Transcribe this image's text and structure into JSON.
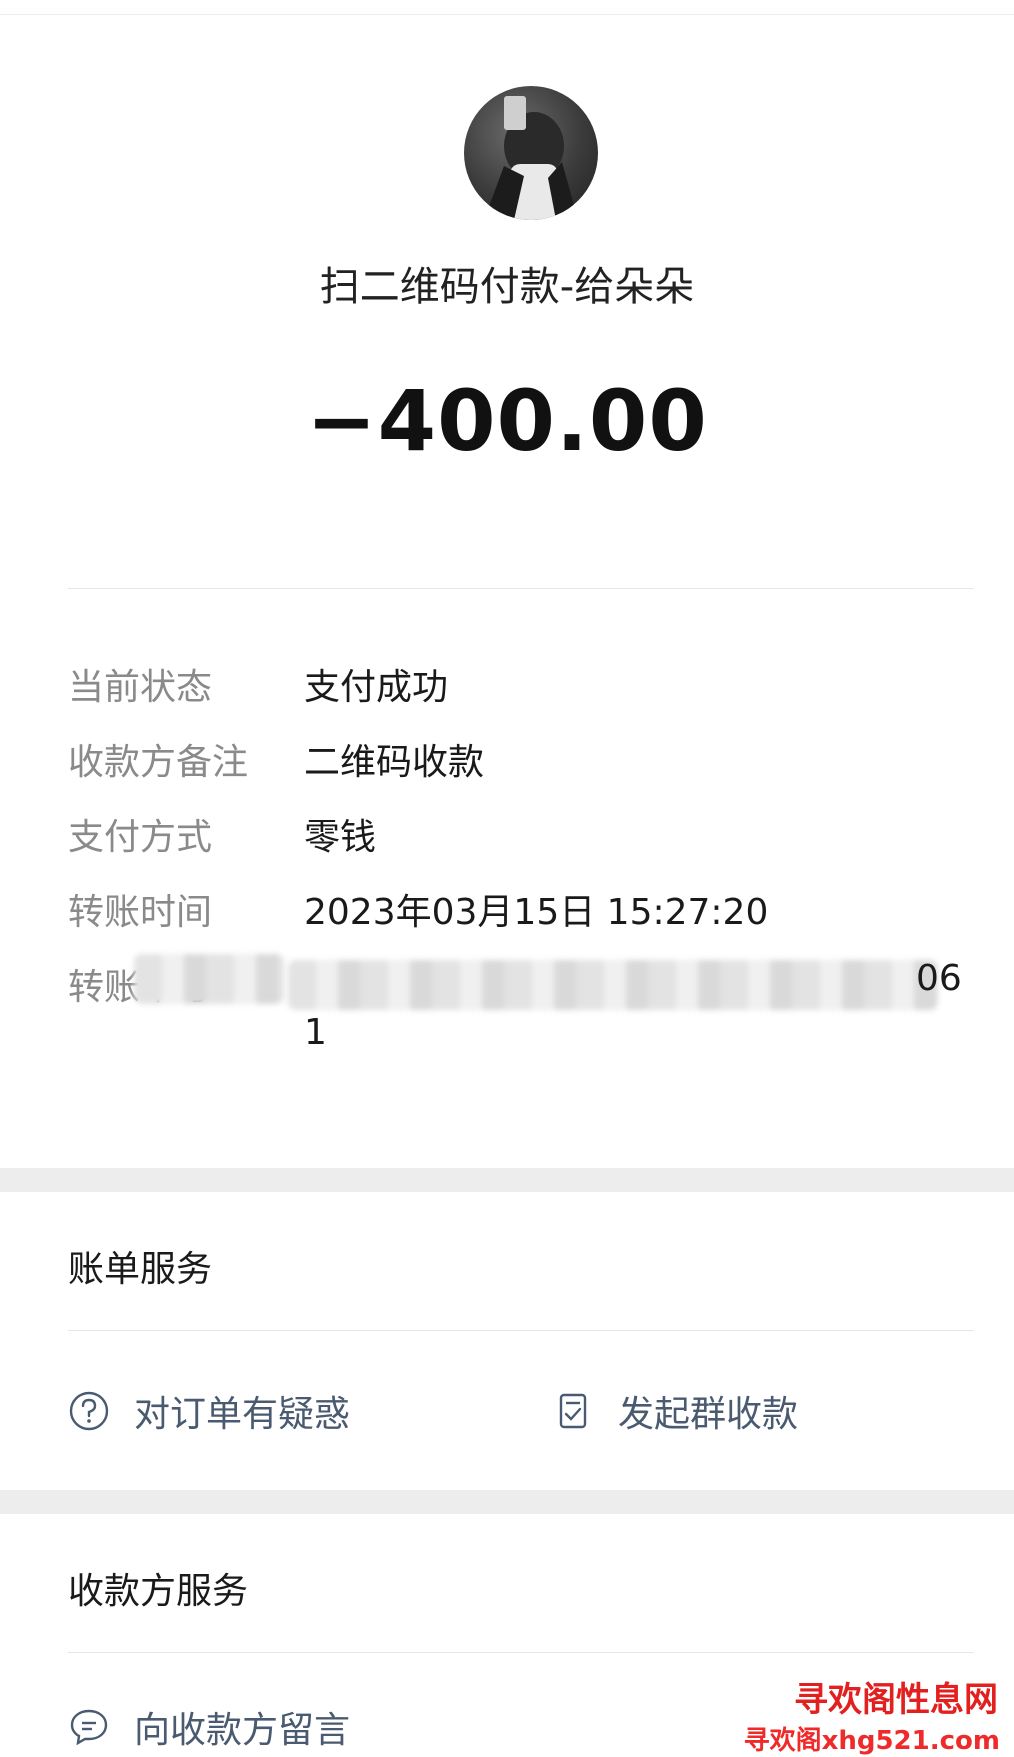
{
  "header": {
    "merchant_title": "扫二维码付款-给朵朵",
    "amount": "−400.00"
  },
  "details": [
    {
      "label": "当前状态",
      "value": "支付成功"
    },
    {
      "label": "收款方备注",
      "value": "二维码收款"
    },
    {
      "label": "支付方式",
      "value": "零钱"
    },
    {
      "label": "转账时间",
      "value": "2023年03月15日 15:27:20"
    },
    {
      "label": "转账单号",
      "value_tail": "06",
      "value_line2": "1"
    }
  ],
  "bill_service": {
    "title": "账单服务",
    "actions": [
      {
        "label": "对订单有疑惑",
        "icon": "question-circle-icon"
      },
      {
        "label": "发起群收款",
        "icon": "group-collect-document-icon"
      }
    ]
  },
  "payee_service": {
    "title": "收款方服务",
    "actions": [
      {
        "label": "向收款方留言",
        "icon": "message-bubble-icon"
      }
    ]
  },
  "watermark": {
    "line1": "寻欢阁性息网",
    "line2": "寻欢阁xhg521.com"
  },
  "colors": {
    "action_text": "#4a5a70",
    "label_text": "#8a8a8a",
    "watermark": "#e32020"
  }
}
